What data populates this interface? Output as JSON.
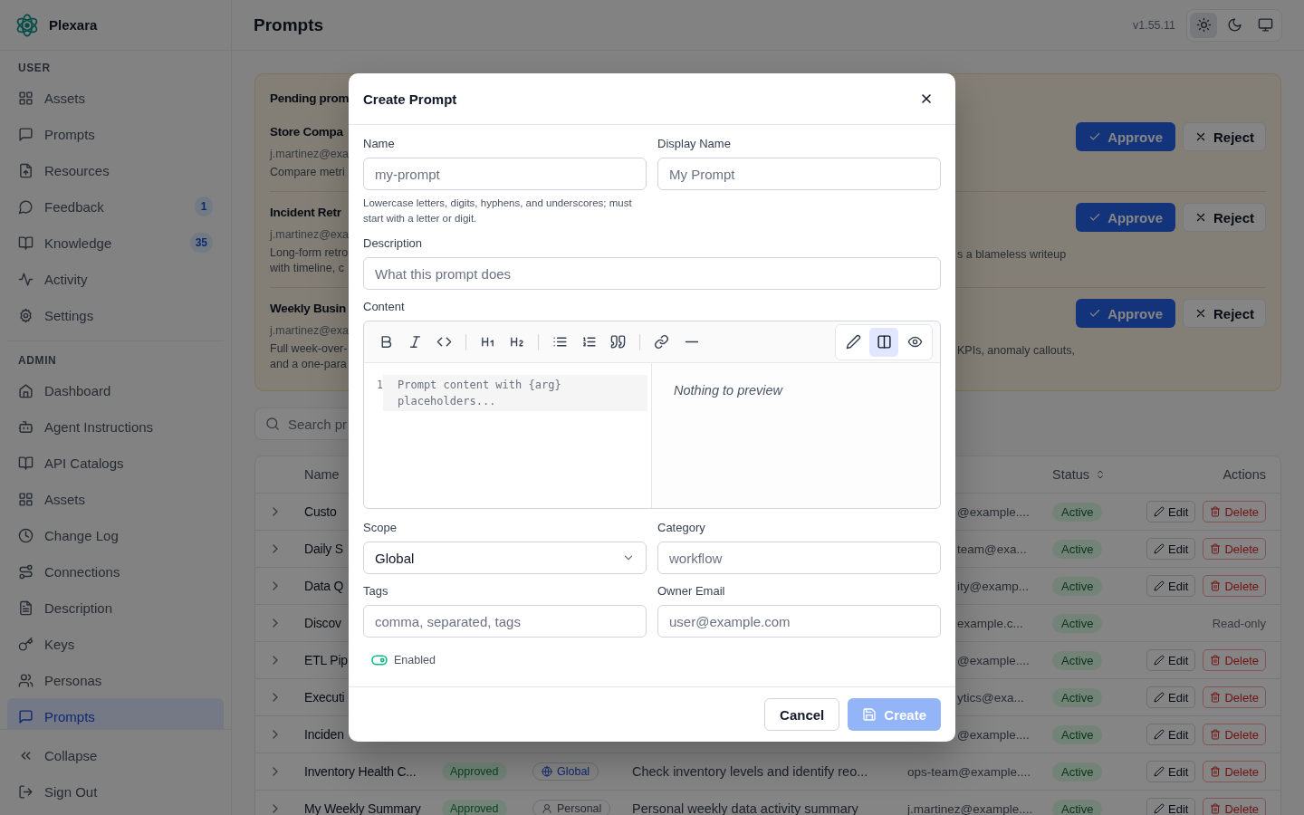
{
  "app": {
    "name": "Plexara"
  },
  "sidebar": {
    "sections": [
      {
        "label": "USER",
        "items": [
          {
            "label": "Assets",
            "selected": false
          },
          {
            "label": "Prompts",
            "selected": false
          },
          {
            "label": "Resources",
            "selected": false
          },
          {
            "label": "Feedback",
            "selected": false,
            "badge": "1"
          },
          {
            "label": "Knowledge",
            "selected": false,
            "badge": "35"
          },
          {
            "label": "Activity",
            "selected": false
          },
          {
            "label": "Settings",
            "selected": false
          }
        ]
      },
      {
        "label": "ADMIN",
        "items": [
          {
            "label": "Dashboard",
            "selected": false
          },
          {
            "label": "Agent Instructions",
            "selected": false
          },
          {
            "label": "API Catalogs",
            "selected": false
          },
          {
            "label": "Assets",
            "selected": false
          },
          {
            "label": "Change Log",
            "selected": false
          },
          {
            "label": "Connections",
            "selected": false
          },
          {
            "label": "Description",
            "selected": false
          },
          {
            "label": "Keys",
            "selected": false
          },
          {
            "label": "Personas",
            "selected": false
          },
          {
            "label": "Prompts",
            "selected": true
          }
        ]
      }
    ],
    "footer": [
      {
        "label": "Collapse"
      },
      {
        "label": "Sign Out"
      }
    ]
  },
  "header": {
    "title": "Prompts",
    "version": "v1.55.11",
    "theme_options": [
      {
        "selected": true
      },
      {
        "selected": false
      },
      {
        "selected": false
      }
    ]
  },
  "pending": {
    "title": "Pending prom",
    "items": [
      {
        "title": "Store Compa",
        "submitter": "j.martinez@exa",
        "description_left": [
          "Compare metri"
        ],
        "approve": "Approve",
        "reject": "Reject"
      },
      {
        "title": "Incident Retr",
        "submitter": "j.martinez@exa",
        "description_left": [
          "Long-form retro",
          "with timeline, c"
        ],
        "description_right": "s a blameless writeup",
        "approve": "Approve",
        "reject": "Reject"
      },
      {
        "title": "Weekly Busin",
        "submitter": "j.martinez@exa",
        "description_left": [
          "Full week-over-",
          "and a one-para"
        ],
        "description_right": "KPIs, anomaly callouts,",
        "approve": "Approve",
        "reject": "Reject"
      }
    ]
  },
  "search": {
    "placeholder": "Search pr"
  },
  "table": {
    "columns": [
      {
        "label": "Name",
        "sortable": false
      },
      {
        "label": "Status",
        "sortable": true
      },
      {
        "label": "Actions",
        "sortable": false
      }
    ],
    "rows": [
      {
        "name": "Custo",
        "owner": "@example....",
        "status": "Active",
        "actions": {
          "kind": "buttons",
          "edit": "Edit",
          "delete": "Delete"
        }
      },
      {
        "name": "Daily S",
        "owner": "team@exa...",
        "status": "Active",
        "actions": {
          "kind": "buttons",
          "edit": "Edit",
          "delete": "Delete"
        }
      },
      {
        "name": "Data Q",
        "owner": "ity@examp...",
        "status": "Active",
        "actions": {
          "kind": "buttons",
          "edit": "Edit",
          "delete": "Delete"
        }
      },
      {
        "name": "Discov",
        "owner": "example.c...",
        "status": "Active",
        "actions": {
          "kind": "read-only",
          "text": "Read-only"
        }
      },
      {
        "name": "ETL Pip",
        "owner": "@example....",
        "status": "Active",
        "actions": {
          "kind": "buttons",
          "edit": "Edit",
          "delete": "Delete"
        }
      },
      {
        "name": "Executi",
        "owner": "ytics@exa...",
        "status": "Active",
        "actions": {
          "kind": "buttons",
          "edit": "Edit",
          "delete": "Delete"
        }
      },
      {
        "name": "Inciden",
        "owner": "@example....",
        "status": "Active",
        "actions": {
          "kind": "buttons",
          "edit": "Edit",
          "delete": "Delete"
        }
      },
      {
        "name": "Inventory Health C...",
        "approval": "Approved",
        "scope": {
          "kind": "global",
          "label": "Global"
        },
        "description": "Check inventory levels and identify reo...",
        "owner": "ops-team@example....",
        "status": "Active",
        "actions": {
          "kind": "buttons",
          "edit": "Edit",
          "delete": "Delete"
        }
      },
      {
        "name": "My Weekly Summary",
        "approval": "Approved",
        "scope": {
          "kind": "personal",
          "label": "Personal"
        },
        "description": "Personal weekly data activity summary",
        "owner": "j.martinez@example....",
        "status": "Active",
        "actions": {
          "kind": "buttons",
          "edit": "Edit",
          "delete": "Delete"
        }
      }
    ]
  },
  "dialog": {
    "title": "Create Prompt",
    "name": {
      "label": "Name",
      "placeholder": "my-prompt",
      "hint": "Lowercase letters, digits, hyphens, and underscores; must start with a letter or digit."
    },
    "display_name": {
      "label": "Display Name",
      "placeholder": "My Prompt"
    },
    "description": {
      "label": "Description",
      "placeholder": "What this prompt does"
    },
    "content": {
      "label": "Content",
      "line_number": "1",
      "placeholder": "Prompt content with {arg} placeholders...",
      "preview": "Nothing to preview",
      "view_modes": [
        {
          "selected": false
        },
        {
          "selected": true
        },
        {
          "selected": false
        }
      ]
    },
    "scope": {
      "label": "Scope",
      "value": "Global"
    },
    "category": {
      "label": "Category",
      "placeholder": "workflow"
    },
    "tags": {
      "label": "Tags",
      "placeholder": "comma, separated, tags"
    },
    "owner_email": {
      "label": "Owner Email",
      "placeholder": "user@example.com"
    },
    "enabled": {
      "label": "Enabled",
      "on": true
    },
    "buttons": [
      {
        "label": "Cancel",
        "kind": "secondary",
        "disabled": false
      },
      {
        "label": "Create",
        "kind": "primary",
        "disabled": true
      }
    ]
  }
}
